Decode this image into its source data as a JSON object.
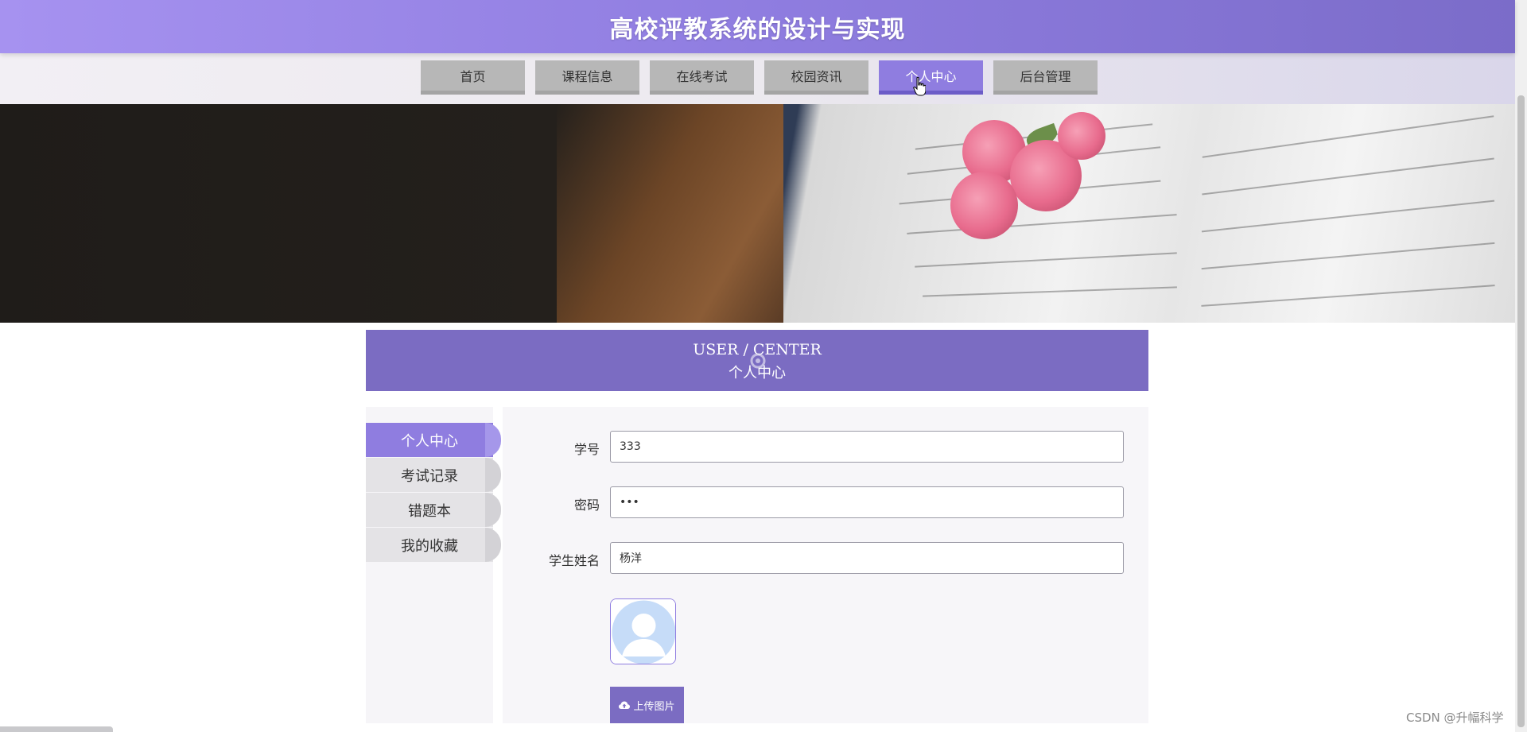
{
  "header": {
    "title": "高校评教系统的设计与实现"
  },
  "nav": {
    "items": [
      {
        "label": "首页"
      },
      {
        "label": "课程信息"
      },
      {
        "label": "在线考试"
      },
      {
        "label": "校园资讯"
      },
      {
        "label": "个人中心",
        "active": true
      },
      {
        "label": "后台管理"
      }
    ]
  },
  "center_header": {
    "title_en": "USER / CENTER",
    "title_zh": "个人中心"
  },
  "side_menu": {
    "items": [
      {
        "label": "个人中心",
        "active": true
      },
      {
        "label": "考试记录"
      },
      {
        "label": "错题本"
      },
      {
        "label": "我的收藏"
      }
    ]
  },
  "form": {
    "student_id": {
      "label": "学号",
      "value": "333"
    },
    "password": {
      "label": "密码",
      "value": "•••"
    },
    "student_name": {
      "label": "学生姓名",
      "value": "杨洋"
    },
    "upload_label": "上传图片"
  },
  "watermark": "CSDN @升幅科学",
  "colors": {
    "accent": "#8f7de0",
    "accent_dark": "#7b6cc2",
    "nav_gray": "#b7b7b7"
  },
  "icons": {
    "avatar": "user-avatar-icon",
    "upload": "cloud-upload-icon",
    "cursor": "hand-pointer-icon"
  }
}
